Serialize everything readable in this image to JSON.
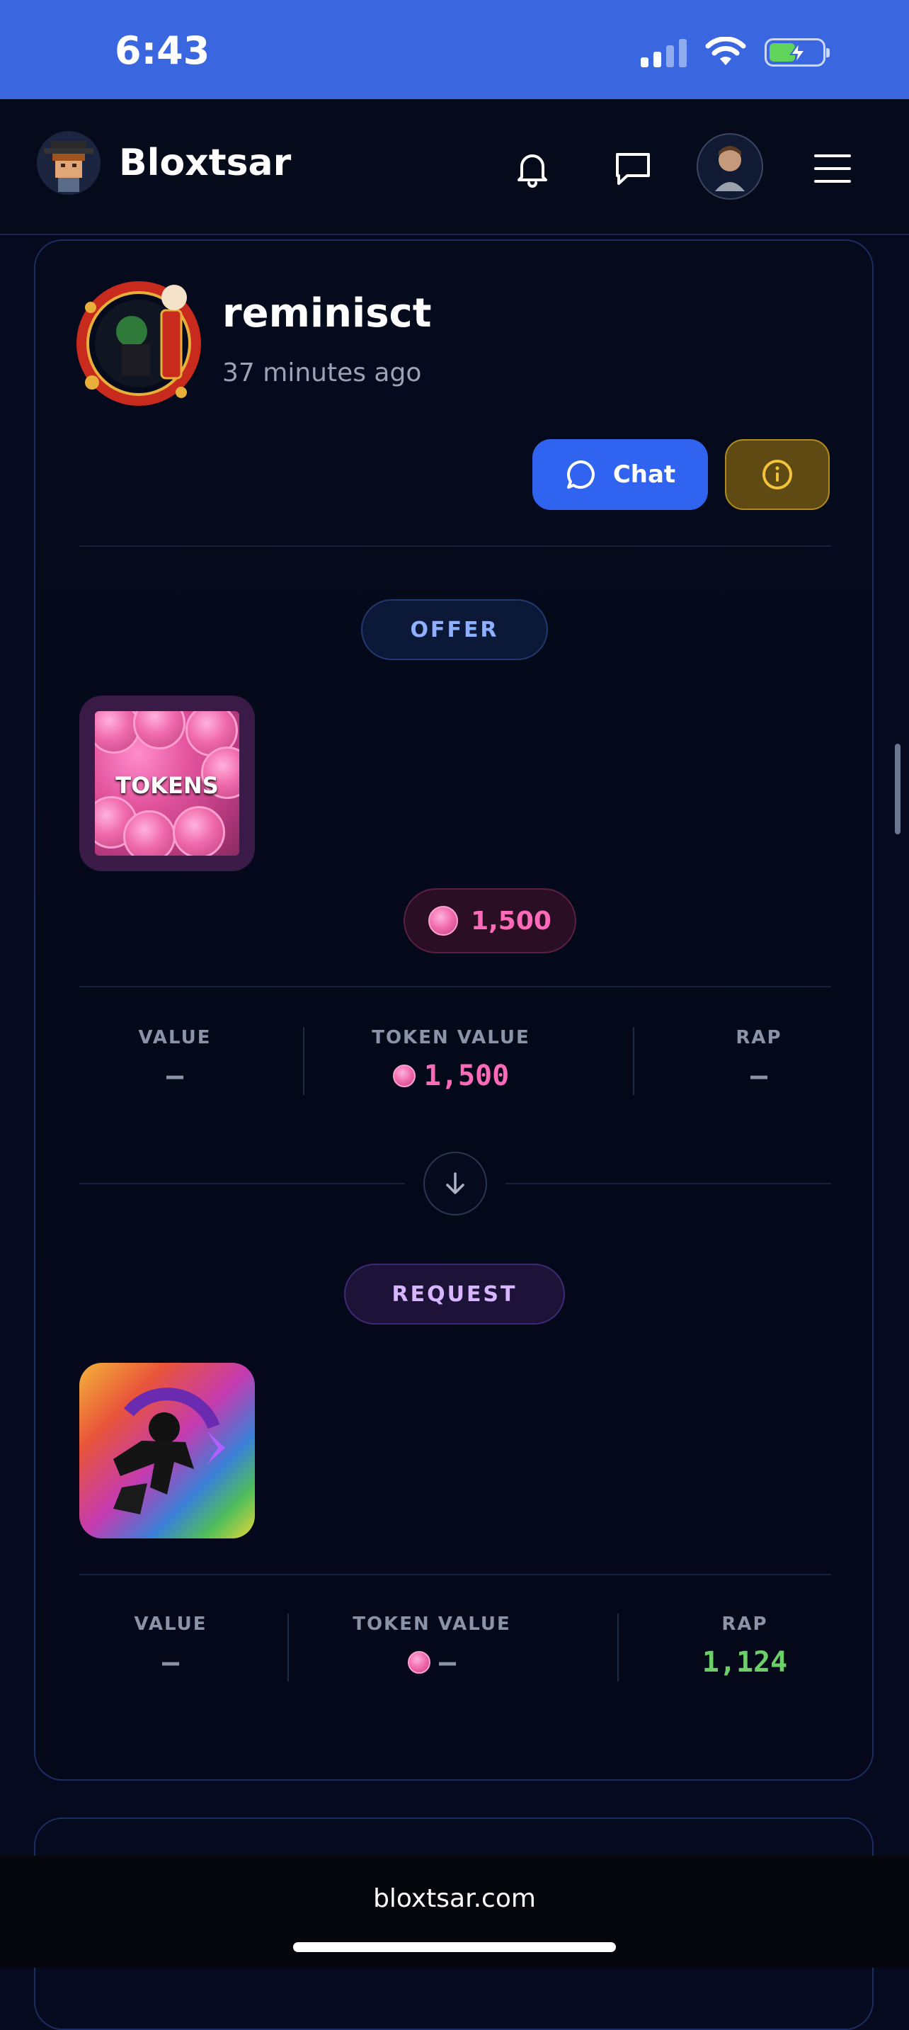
{
  "status_bar": {
    "time": "6:43"
  },
  "nav": {
    "brand": "Bloxtsar"
  },
  "trade": {
    "username": "reminisct",
    "timestamp": "37 minutes ago",
    "chat_label": "Chat",
    "offer": {
      "pill": "OFFER",
      "item_label": "TOKENS",
      "amount": "1,500",
      "stats": {
        "value_label": "VALUE",
        "value": "–",
        "token_value_label": "TOKEN VALUE",
        "token_value": "1,500",
        "rap_label": "RAP",
        "rap": "–"
      }
    },
    "request": {
      "pill": "REQUEST",
      "stats": {
        "value_label": "VALUE",
        "value": "–",
        "token_value_label": "TOKEN VALUE",
        "token_value": "–",
        "rap_label": "RAP",
        "rap": "1,124"
      }
    }
  },
  "browser": {
    "url": "bloxtsar.com"
  },
  "colors": {
    "accent": "#2f63f0",
    "token_pink": "#ff6ab8",
    "rap_green": "#6ecf6a"
  }
}
